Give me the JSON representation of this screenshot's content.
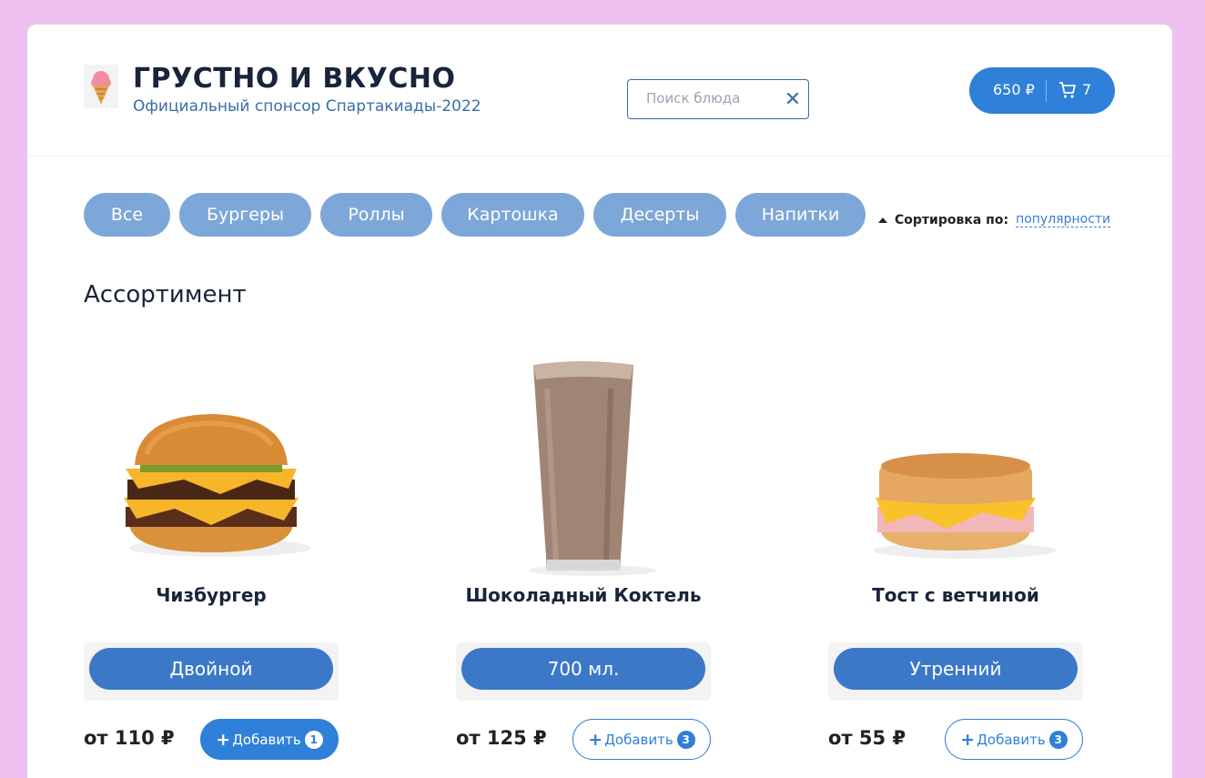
{
  "header": {
    "title": "ГРУСТНО И ВКУСНО",
    "subtitle": "Официальный спонсор Спартакиады-2022",
    "logo_icon": "ice-cream-icon"
  },
  "search": {
    "placeholder": "Поиск блюда",
    "value": ""
  },
  "cart": {
    "total": "650 ₽",
    "count": "7"
  },
  "categories": [
    {
      "label": "Все"
    },
    {
      "label": "Бургеры"
    },
    {
      "label": "Роллы"
    },
    {
      "label": "Картошка"
    },
    {
      "label": "Десерты"
    },
    {
      "label": "Напитки"
    }
  ],
  "sort": {
    "label": "Сортировка по:",
    "value": "популярности"
  },
  "section_title": "Ассортимент",
  "products": [
    {
      "name": "Чизбургер",
      "variant": "Двойной",
      "price": "от 110 ₽",
      "add_label": "Добавить",
      "count": "1",
      "selected": true
    },
    {
      "name": "Шоколадный Коктель",
      "variant": "700 мл.",
      "price": "от 125 ₽",
      "add_label": "Добавить",
      "count": "3",
      "selected": false
    },
    {
      "name": "Тост с ветчиной",
      "variant": "Утренний",
      "price": "от 55 ₽",
      "add_label": "Добавить",
      "count": "3",
      "selected": false
    }
  ],
  "colors": {
    "background": "#efc1f0",
    "accent": "#2f80d8",
    "category_pill": "#7da7d8",
    "title_text": "#18243a"
  }
}
